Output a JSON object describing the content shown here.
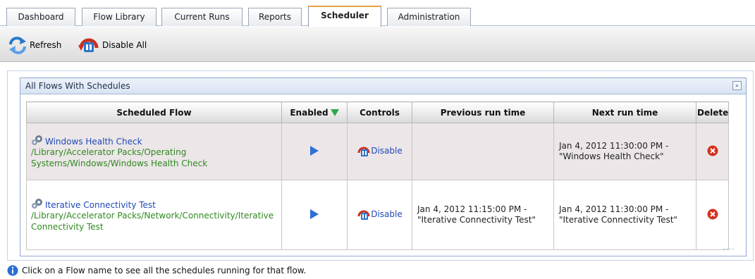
{
  "tabs": [
    {
      "label": "Dashboard"
    },
    {
      "label": "Flow Library"
    },
    {
      "label": "Current Runs"
    },
    {
      "label": "Reports"
    },
    {
      "label": "Scheduler"
    },
    {
      "label": "Administration"
    }
  ],
  "active_tab": "Scheduler",
  "toolbar": {
    "refresh_label": "Refresh",
    "disable_all_label": "Disable All"
  },
  "panel": {
    "title": "All Flows With Schedules",
    "collapse_symbol": "»"
  },
  "table": {
    "columns": [
      "Scheduled Flow",
      "Enabled",
      "Controls",
      "Previous run time",
      "Next run time",
      "Delete"
    ],
    "rows": [
      {
        "flow_name": "Windows Health Check",
        "flow_path": "/Library/Accelerator Packs/Operating Systems/Windows/Windows Health Check",
        "control_label": "Disable",
        "previous_run": "",
        "next_run": "Jan 4, 2012 11:30:00 PM - \"Windows Health Check\""
      },
      {
        "flow_name": "Iterative Connectivity Test",
        "flow_path": "/Library/Accelerator Packs/Network/Connectivity/Iterative Connectivity Test",
        "control_label": "Disable",
        "previous_run": "Jan 4, 2012 11:15:00 PM - \"Iterative Connectivity Test\"",
        "next_run": "Jan 4, 2012 11:30:00 PM - \"Iterative Connectivity Test\""
      }
    ]
  },
  "footer": {
    "info_text": "Click on a Flow name to see all the schedules running for that flow."
  },
  "colors": {
    "link_blue": "#1f49b8",
    "path_green": "#2f8a1f",
    "play_blue": "#2f6fd6",
    "delete_red": "#d4321e",
    "tab_accent": "#e2a23b"
  }
}
